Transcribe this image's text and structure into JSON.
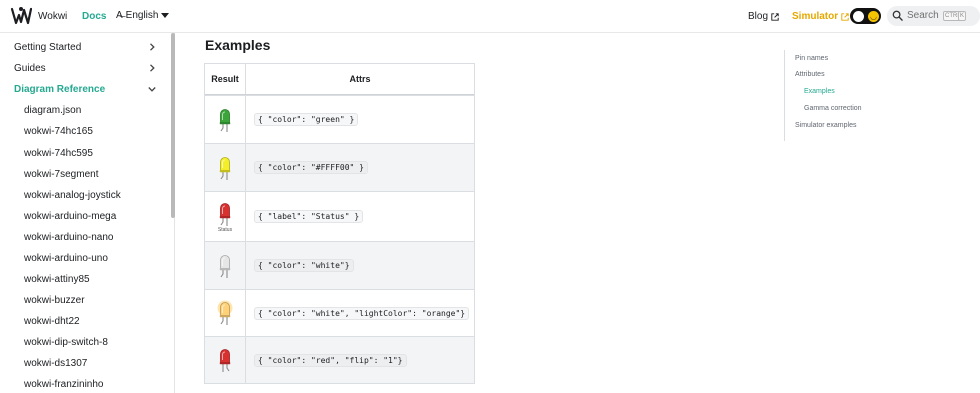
{
  "navbar": {
    "brand": "Wokwi",
    "docs": "Docs",
    "language": "English",
    "blog": "Blog",
    "simulator": "Simulator",
    "search_placeholder": "Search",
    "kbd_ctrl": "CTRL",
    "kbd_k": "K"
  },
  "sidebar": {
    "categories": [
      {
        "label": "Getting Started"
      },
      {
        "label": "Guides"
      },
      {
        "label": "Diagram Reference"
      }
    ],
    "items": [
      "diagram.json",
      "wokwi-74hc165",
      "wokwi-74hc595",
      "wokwi-7segment",
      "wokwi-analog-joystick",
      "wokwi-arduino-mega",
      "wokwi-arduino-nano",
      "wokwi-arduino-uno",
      "wokwi-attiny85",
      "wokwi-buzzer",
      "wokwi-dht22",
      "wokwi-dip-switch-8",
      "wokwi-ds1307",
      "wokwi-franzininho"
    ]
  },
  "main": {
    "heading": "Examples",
    "table": {
      "headers": {
        "result": "Result",
        "attrs": "Attrs"
      },
      "rows": [
        {
          "led_color": "#3aa63a",
          "attrs": "{ \"color\": \"green\" }"
        },
        {
          "led_color": "#f2ee2a",
          "attrs": "{ \"color\": \"#FFFF00\" }"
        },
        {
          "led_color": "#d93030",
          "led_label": "Status",
          "attrs": "{ \"label\": \"Status\" }"
        },
        {
          "led_color": "#e6e6e6",
          "attrs": "{ \"color\": \"white\"}"
        },
        {
          "led_color": "#ffd27a",
          "attrs": "{ \"color\": \"white\", \"lightColor\": \"orange\"}"
        },
        {
          "led_color": "#d93030",
          "attrs": "{ \"color\": \"red\", \"flip\": \"1\"}"
        }
      ]
    }
  },
  "toc": {
    "items": [
      {
        "label": "Pin names"
      },
      {
        "label": "Attributes"
      },
      {
        "label": "Examples"
      },
      {
        "label": "Gamma correction"
      },
      {
        "label": "Simulator examples"
      }
    ]
  },
  "colors": {
    "accent": "#25a991",
    "simulator": "#e6a800"
  },
  "icons": [
    "wokwi-logo-icon",
    "translate-icon",
    "external-link-icon",
    "moon-icon",
    "sun-icon",
    "search-icon",
    "chevron-right-icon",
    "chevron-down-icon",
    "led-icon"
  ]
}
